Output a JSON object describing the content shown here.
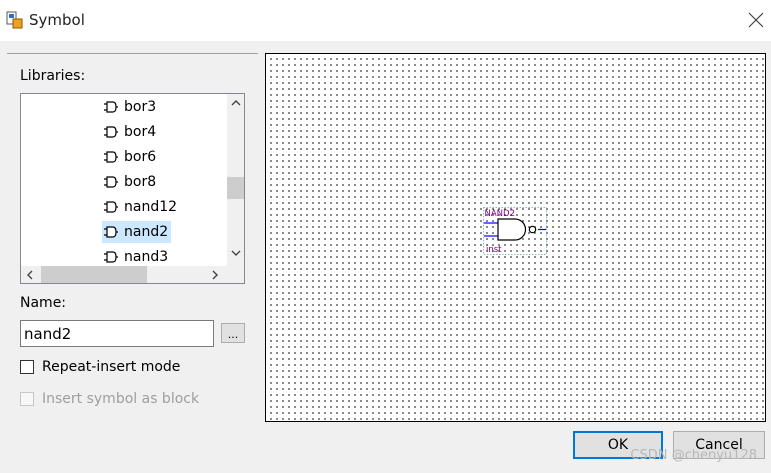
{
  "window": {
    "title": "Symbol"
  },
  "libraries": {
    "label": "Libraries:",
    "items": [
      {
        "label": "bor3",
        "icon": "symbol-icon"
      },
      {
        "label": "bor4",
        "icon": "symbol-icon"
      },
      {
        "label": "bor6",
        "icon": "symbol-icon"
      },
      {
        "label": "bor8",
        "icon": "symbol-icon"
      },
      {
        "label": "nand12",
        "icon": "symbol-icon"
      },
      {
        "label": "nand2",
        "icon": "symbol-icon",
        "selected": true
      },
      {
        "label": "nand3",
        "icon": "symbol-icon"
      }
    ]
  },
  "name": {
    "label": "Name:",
    "value": "nand2",
    "browse_label": "..."
  },
  "options": {
    "repeat_insert": {
      "label": "Repeat-insert mode",
      "checked": false,
      "enabled": true
    },
    "insert_as_block": {
      "label": "Insert symbol as block",
      "checked": false,
      "enabled": false
    }
  },
  "preview": {
    "symbol_name": "NAND2",
    "instance_name": "inst"
  },
  "buttons": {
    "ok": "OK",
    "cancel": "Cancel"
  },
  "watermark": "CSDN @chenyu128",
  "colors": {
    "symbol_text": "#800080",
    "selection": "#cce8ff",
    "ok_border": "#0078d7"
  }
}
